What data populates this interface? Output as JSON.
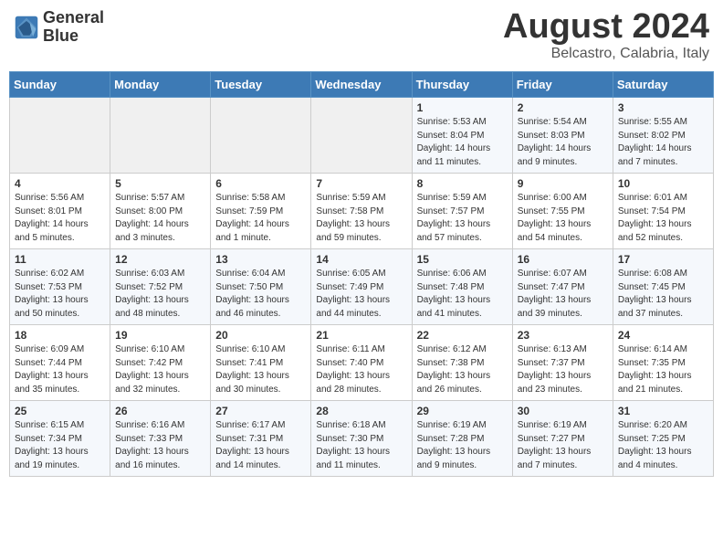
{
  "header": {
    "logo_line1": "General",
    "logo_line2": "Blue",
    "month_year": "August 2024",
    "location": "Belcastro, Calabria, Italy"
  },
  "days_of_week": [
    "Sunday",
    "Monday",
    "Tuesday",
    "Wednesday",
    "Thursday",
    "Friday",
    "Saturday"
  ],
  "weeks": [
    [
      {
        "day": "",
        "content": ""
      },
      {
        "day": "",
        "content": ""
      },
      {
        "day": "",
        "content": ""
      },
      {
        "day": "",
        "content": ""
      },
      {
        "day": "1",
        "content": "Sunrise: 5:53 AM\nSunset: 8:04 PM\nDaylight: 14 hours\nand 11 minutes."
      },
      {
        "day": "2",
        "content": "Sunrise: 5:54 AM\nSunset: 8:03 PM\nDaylight: 14 hours\nand 9 minutes."
      },
      {
        "day": "3",
        "content": "Sunrise: 5:55 AM\nSunset: 8:02 PM\nDaylight: 14 hours\nand 7 minutes."
      }
    ],
    [
      {
        "day": "4",
        "content": "Sunrise: 5:56 AM\nSunset: 8:01 PM\nDaylight: 14 hours\nand 5 minutes."
      },
      {
        "day": "5",
        "content": "Sunrise: 5:57 AM\nSunset: 8:00 PM\nDaylight: 14 hours\nand 3 minutes."
      },
      {
        "day": "6",
        "content": "Sunrise: 5:58 AM\nSunset: 7:59 PM\nDaylight: 14 hours\nand 1 minute."
      },
      {
        "day": "7",
        "content": "Sunrise: 5:59 AM\nSunset: 7:58 PM\nDaylight: 13 hours\nand 59 minutes."
      },
      {
        "day": "8",
        "content": "Sunrise: 5:59 AM\nSunset: 7:57 PM\nDaylight: 13 hours\nand 57 minutes."
      },
      {
        "day": "9",
        "content": "Sunrise: 6:00 AM\nSunset: 7:55 PM\nDaylight: 13 hours\nand 54 minutes."
      },
      {
        "day": "10",
        "content": "Sunrise: 6:01 AM\nSunset: 7:54 PM\nDaylight: 13 hours\nand 52 minutes."
      }
    ],
    [
      {
        "day": "11",
        "content": "Sunrise: 6:02 AM\nSunset: 7:53 PM\nDaylight: 13 hours\nand 50 minutes."
      },
      {
        "day": "12",
        "content": "Sunrise: 6:03 AM\nSunset: 7:52 PM\nDaylight: 13 hours\nand 48 minutes."
      },
      {
        "day": "13",
        "content": "Sunrise: 6:04 AM\nSunset: 7:50 PM\nDaylight: 13 hours\nand 46 minutes."
      },
      {
        "day": "14",
        "content": "Sunrise: 6:05 AM\nSunset: 7:49 PM\nDaylight: 13 hours\nand 44 minutes."
      },
      {
        "day": "15",
        "content": "Sunrise: 6:06 AM\nSunset: 7:48 PM\nDaylight: 13 hours\nand 41 minutes."
      },
      {
        "day": "16",
        "content": "Sunrise: 6:07 AM\nSunset: 7:47 PM\nDaylight: 13 hours\nand 39 minutes."
      },
      {
        "day": "17",
        "content": "Sunrise: 6:08 AM\nSunset: 7:45 PM\nDaylight: 13 hours\nand 37 minutes."
      }
    ],
    [
      {
        "day": "18",
        "content": "Sunrise: 6:09 AM\nSunset: 7:44 PM\nDaylight: 13 hours\nand 35 minutes."
      },
      {
        "day": "19",
        "content": "Sunrise: 6:10 AM\nSunset: 7:42 PM\nDaylight: 13 hours\nand 32 minutes."
      },
      {
        "day": "20",
        "content": "Sunrise: 6:10 AM\nSunset: 7:41 PM\nDaylight: 13 hours\nand 30 minutes."
      },
      {
        "day": "21",
        "content": "Sunrise: 6:11 AM\nSunset: 7:40 PM\nDaylight: 13 hours\nand 28 minutes."
      },
      {
        "day": "22",
        "content": "Sunrise: 6:12 AM\nSunset: 7:38 PM\nDaylight: 13 hours\nand 26 minutes."
      },
      {
        "day": "23",
        "content": "Sunrise: 6:13 AM\nSunset: 7:37 PM\nDaylight: 13 hours\nand 23 minutes."
      },
      {
        "day": "24",
        "content": "Sunrise: 6:14 AM\nSunset: 7:35 PM\nDaylight: 13 hours\nand 21 minutes."
      }
    ],
    [
      {
        "day": "25",
        "content": "Sunrise: 6:15 AM\nSunset: 7:34 PM\nDaylight: 13 hours\nand 19 minutes."
      },
      {
        "day": "26",
        "content": "Sunrise: 6:16 AM\nSunset: 7:33 PM\nDaylight: 13 hours\nand 16 minutes."
      },
      {
        "day": "27",
        "content": "Sunrise: 6:17 AM\nSunset: 7:31 PM\nDaylight: 13 hours\nand 14 minutes."
      },
      {
        "day": "28",
        "content": "Sunrise: 6:18 AM\nSunset: 7:30 PM\nDaylight: 13 hours\nand 11 minutes."
      },
      {
        "day": "29",
        "content": "Sunrise: 6:19 AM\nSunset: 7:28 PM\nDaylight: 13 hours\nand 9 minutes."
      },
      {
        "day": "30",
        "content": "Sunrise: 6:19 AM\nSunset: 7:27 PM\nDaylight: 13 hours\nand 7 minutes."
      },
      {
        "day": "31",
        "content": "Sunrise: 6:20 AM\nSunset: 7:25 PM\nDaylight: 13 hours\nand 4 minutes."
      }
    ]
  ]
}
